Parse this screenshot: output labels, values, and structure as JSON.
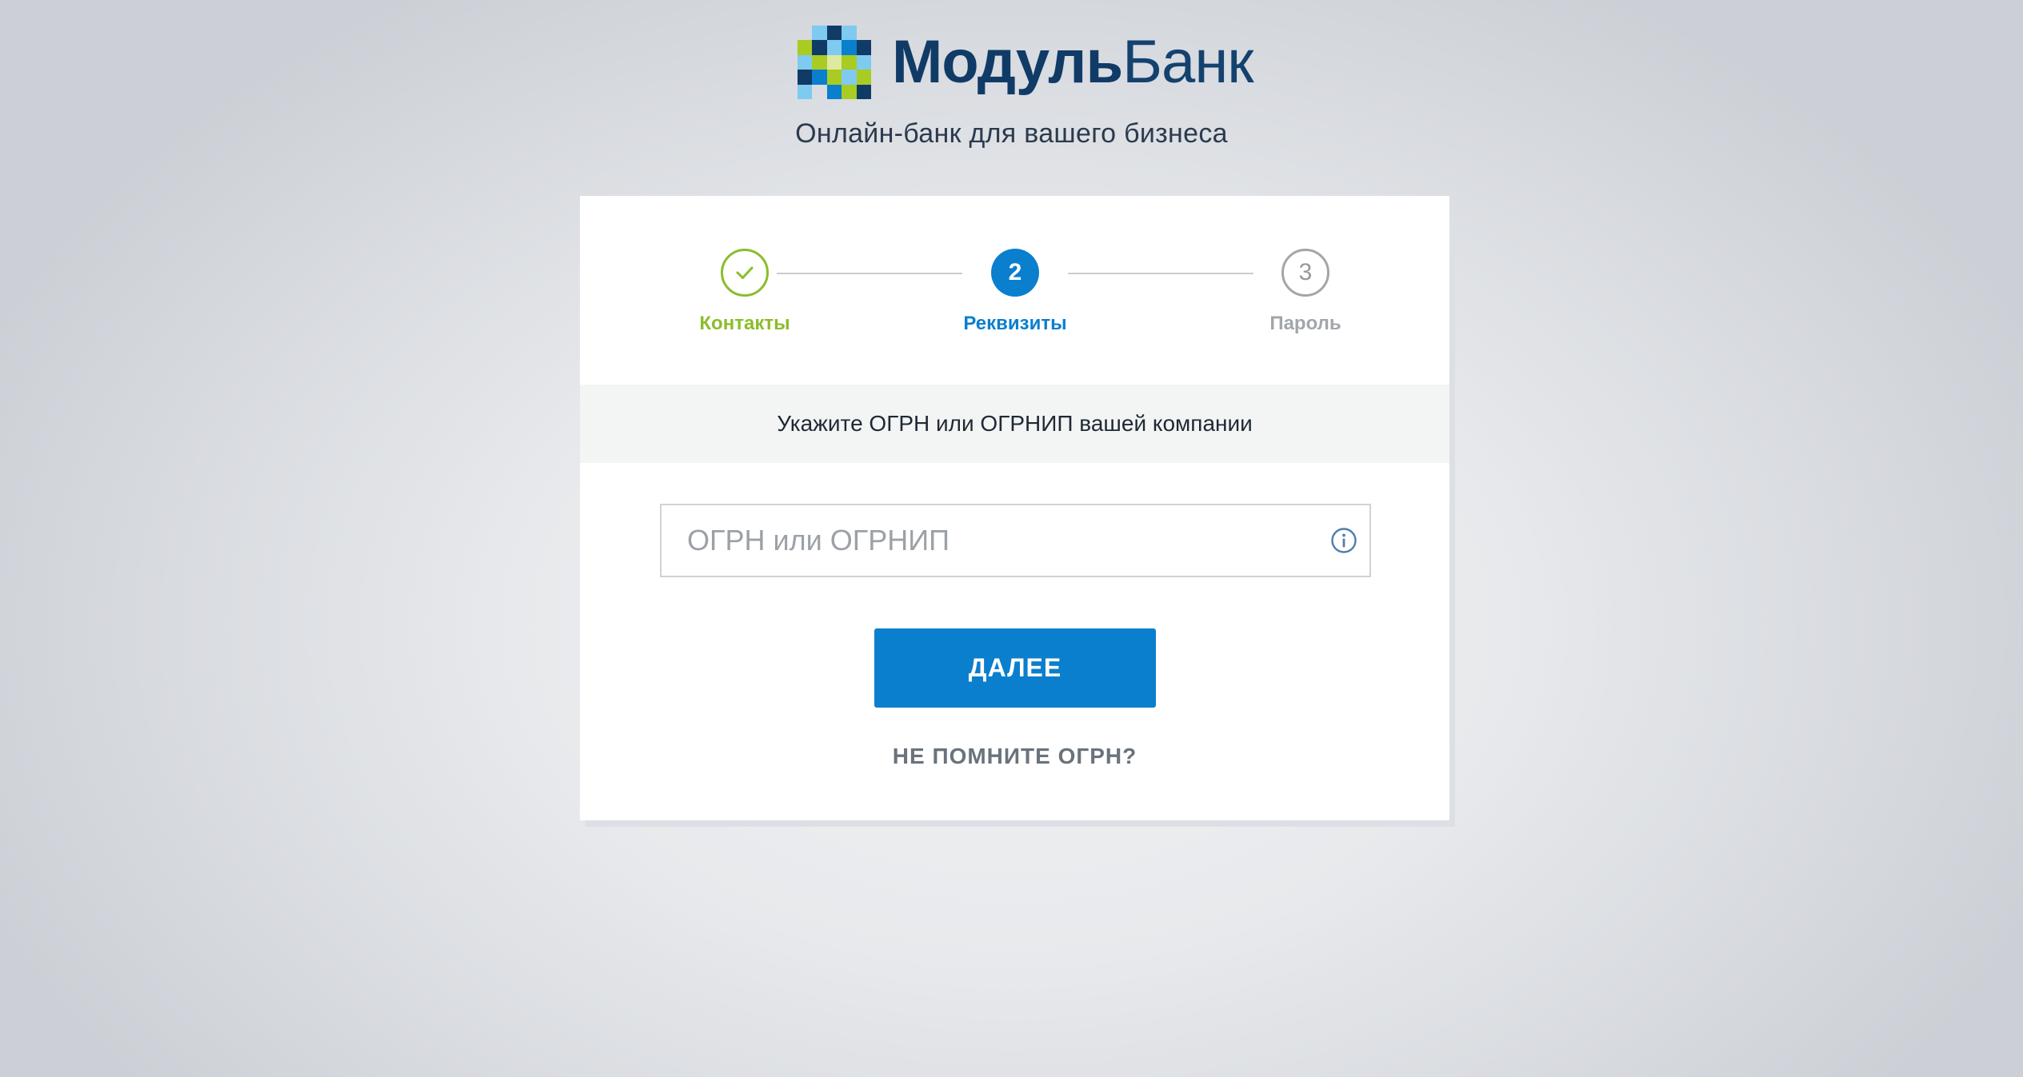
{
  "brand": {
    "name_bold": "Модуль",
    "name_light": "Банк",
    "tagline": "Онлайн-банк для вашего бизнеса",
    "colors": {
      "navy": "#103b66",
      "light_blue": "#7fcaf0",
      "blue": "#0a7fcd",
      "lime": "#a8cc22"
    }
  },
  "steps": [
    {
      "number": "1",
      "label": "Контакты",
      "status": "done",
      "icon": "check-icon"
    },
    {
      "number": "2",
      "label": "Реквизиты",
      "status": "active"
    },
    {
      "number": "3",
      "label": "Пароль",
      "status": "todo"
    }
  ],
  "form": {
    "prompt": "Укажите ОГРН или ОГРНИП вашей компании",
    "ogrn_placeholder": "ОГРН или ОГРНИП",
    "ogrn_value": "",
    "info_icon": "info-icon",
    "next_label": "ДАЛЕЕ",
    "forgot_label": "НЕ ПОМНИТЕ ОГРН?"
  },
  "colors": {
    "accent": "#0a7fcd",
    "success": "#8bbd2b",
    "muted": "#a2a6ab",
    "text_dark": "#2c3a4d"
  }
}
